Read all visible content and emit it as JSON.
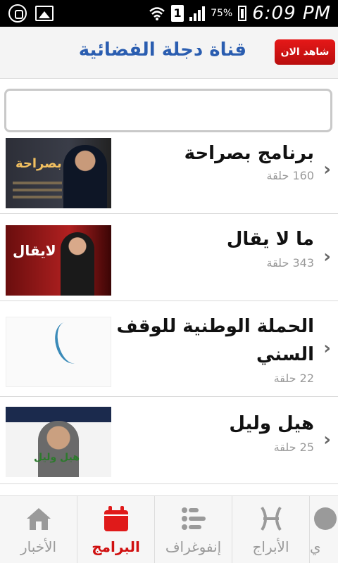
{
  "status_bar": {
    "battery_percent": "75%",
    "sim_label": "1",
    "time": "6:09 PM"
  },
  "header": {
    "title": "قناة دجلة الفضائية",
    "watch_now_label": "شاهد الان"
  },
  "search": {
    "value": "",
    "placeholder": ""
  },
  "programs": [
    {
      "title": "برنامج بصراحة",
      "count": "160 حلقة",
      "thumb_text": "بصراحة"
    },
    {
      "title": "ما لا يقال",
      "count": "343 حلقة",
      "thumb_text": "ما لايقال"
    },
    {
      "title": "الحملة الوطنية للوقف السني",
      "count": "22 حلقة",
      "thumb_text": ""
    },
    {
      "title": "هيل وليل",
      "count": "25 حلقة",
      "thumb_text": "هيل وليل"
    }
  ],
  "tabs": [
    {
      "label": "الأخبار",
      "icon": "home-icon",
      "active": false
    },
    {
      "label": "البرامج",
      "icon": "calendar-icon",
      "active": true
    },
    {
      "label": "إنفوغراف",
      "icon": "list-icon",
      "active": false
    },
    {
      "label": "الأبراج",
      "icon": "pisces-icon",
      "active": false
    },
    {
      "label": "ي",
      "icon": "more-icon",
      "active": false
    }
  ],
  "colors": {
    "accent": "#d01010",
    "title_blue": "#2a5db0",
    "muted_text": "#9a9a9a"
  }
}
